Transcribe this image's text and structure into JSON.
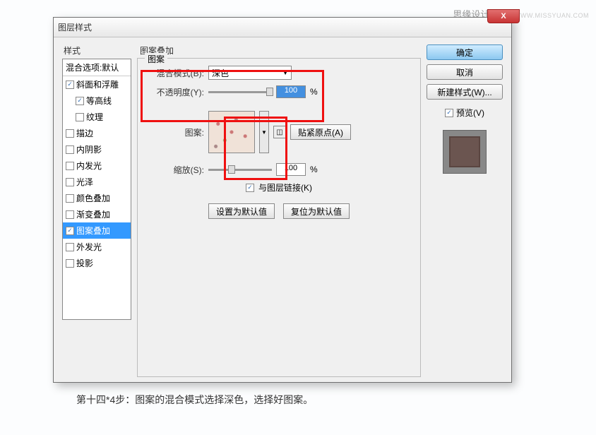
{
  "watermark": {
    "main": "思缘设计论坛",
    "sub": "WWW.MISSYUAN.COM"
  },
  "dialog": {
    "title": "图层样式"
  },
  "closeBtn": "X",
  "stylesGroup": "样式",
  "styleItems": {
    "blendOptions": "混合选项:默认",
    "bevelEmboss": "斜面和浮雕",
    "contour": "等高线",
    "texture": "纹理",
    "stroke": "描边",
    "innerShadow": "内阴影",
    "innerGlow": "内发光",
    "satin": "光泽",
    "colorOverlay": "颜色叠加",
    "gradientOverlay": "渐变叠加",
    "patternOverlay": "图案叠加",
    "outerGlow": "外发光",
    "dropShadow": "投影"
  },
  "panel": {
    "sectionTitle": "图案叠加",
    "fieldsetLabel": "图案",
    "blendModeLabel": "混合模式(B):",
    "blendModeValue": "深色",
    "opacityLabel": "不透明度(Y):",
    "opacityValue": "100",
    "percent": "%",
    "patternLabel": "图案:",
    "snapBtn": "贴紧原点(A)",
    "scaleLabel": "缩放(S):",
    "scaleValue": "100",
    "linkLabel": "与图层链接(K)",
    "setDefault": "设置为默认值",
    "resetDefault": "复位为默认值"
  },
  "side": {
    "ok": "确定",
    "cancel": "取消",
    "newStyle": "新建样式(W)...",
    "previewLabel": "预览(V)"
  },
  "caption": "第十四*4步：图案的混合模式选择深色，选择好图案。"
}
